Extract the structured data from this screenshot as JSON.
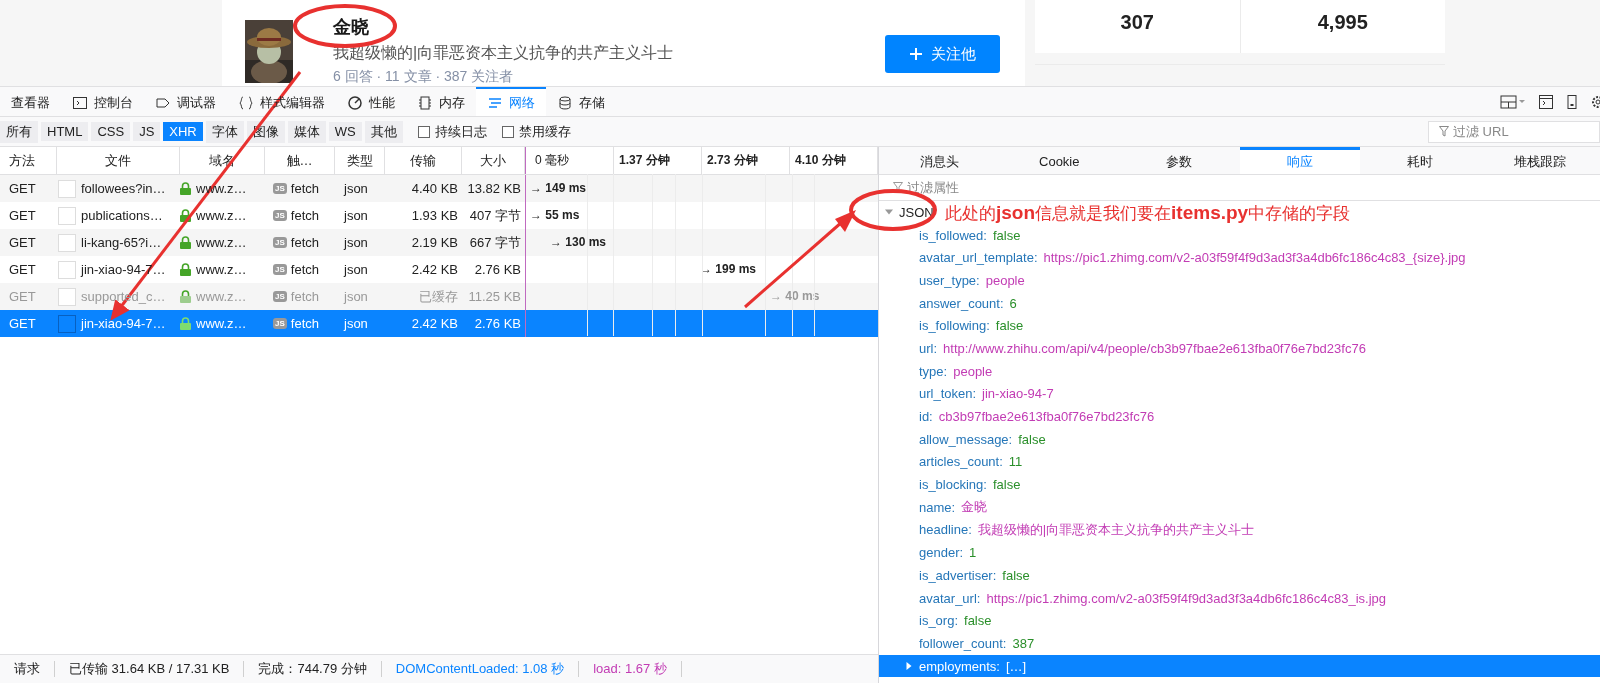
{
  "profile": {
    "name": "金晓",
    "headline": "我超级懒的|向罪恶资本主义抗争的共产主义斗士",
    "meta": "6 回答 · 11 文章 · 387 关注者",
    "follow_button": "关注他"
  },
  "stats": [
    "307",
    "4,995"
  ],
  "devtools": {
    "tabs": [
      {
        "label": "查看器",
        "selected": false
      },
      {
        "label": "控制台",
        "selected": false
      },
      {
        "label": "调试器",
        "selected": false
      },
      {
        "label": "样式编辑器",
        "selected": false
      },
      {
        "label": "性能",
        "selected": false
      },
      {
        "label": "内存",
        "selected": false
      },
      {
        "label": "网络",
        "selected": true
      },
      {
        "label": "存储",
        "selected": false
      }
    ],
    "filters": [
      {
        "label": "所有",
        "selected": false
      },
      {
        "label": "HTML",
        "selected": false
      },
      {
        "label": "CSS",
        "selected": false
      },
      {
        "label": "JS",
        "selected": false
      },
      {
        "label": "XHR",
        "selected": true
      },
      {
        "label": "字体",
        "selected": false
      },
      {
        "label": "图像",
        "selected": false
      },
      {
        "label": "媒体",
        "selected": false
      },
      {
        "label": "WS",
        "selected": false
      },
      {
        "label": "其他",
        "selected": false
      }
    ],
    "checkboxes": [
      {
        "label": "持续日志",
        "checked": false
      },
      {
        "label": "禁用缓存",
        "checked": false
      }
    ],
    "url_filter": {
      "placeholder": "过滤 URL"
    }
  },
  "requests": {
    "columns": [
      "方法",
      "文件",
      "域名",
      "触…",
      "类型",
      "传输",
      "大小"
    ],
    "timeline_ticks": [
      "0 毫秒",
      "1.37 分钟",
      "2.73 分钟",
      "4.10 分钟"
    ],
    "rows": [
      {
        "method": "GET",
        "file": "followees?in…",
        "domain": "www.z…",
        "badge": "JS",
        "cause": "fetch",
        "type": "json",
        "transferred": "4.40 KB",
        "size": "13.82 KB",
        "timing": "→ 149 ms",
        "cached": false,
        "selected": false
      },
      {
        "method": "GET",
        "file": "publications…",
        "domain": "www.z…",
        "badge": "JS",
        "cause": "fetch",
        "type": "json",
        "transferred": "1.93 KB",
        "size": "407 字节",
        "timing": "→ 55 ms",
        "cached": false,
        "selected": false
      },
      {
        "method": "GET",
        "file": "li-kang-65?i…",
        "domain": "www.z…",
        "badge": "JS",
        "cause": "fetch",
        "type": "json",
        "transferred": "2.19 KB",
        "size": "667 字节",
        "timing": "→ 130 ms",
        "cached": false,
        "selected": false
      },
      {
        "method": "GET",
        "file": "jin-xiao-94-7…",
        "domain": "www.z…",
        "badge": "JS",
        "cause": "fetch",
        "type": "json",
        "transferred": "2.42 KB",
        "size": "2.76 KB",
        "timing": "→ 199 ms",
        "cached": false,
        "selected": false
      },
      {
        "method": "GET",
        "file": "supported_c…",
        "domain": "www.z…",
        "badge": "JS",
        "cause": "fetch",
        "type": "json",
        "transferred": "已缓存",
        "size": "11.25 KB",
        "timing": "→ 40 ms",
        "cached": true,
        "selected": false
      },
      {
        "method": "GET",
        "file": "jin-xiao-94-7…",
        "domain": "www.z…",
        "badge": "JS",
        "cause": "fetch",
        "type": "json",
        "transferred": "2.42 KB",
        "size": "2.76 KB",
        "cached": false,
        "selected": true
      }
    ]
  },
  "status_bar": [
    {
      "text": "请求",
      "kind": "plain"
    },
    {
      "text": "已传输 31.64 KB / 17.31 KB",
      "kind": "plain"
    },
    {
      "text": "完成：744.79 分钟",
      "kind": "plain"
    },
    {
      "text": "DOMContentLoaded: 1.08 秒",
      "kind": "dcl"
    },
    {
      "text": "load: 1.67 秒",
      "kind": "load"
    }
  ],
  "response": {
    "tabs": [
      {
        "label": "消息头",
        "selected": false
      },
      {
        "label": "Cookie",
        "selected": false
      },
      {
        "label": "参数",
        "selected": false
      },
      {
        "label": "响应",
        "selected": true
      },
      {
        "label": "耗时",
        "selected": false
      },
      {
        "label": "堆栈跟踪",
        "selected": false
      }
    ],
    "filter": {
      "placeholder": "过滤属性"
    },
    "tree": {
      "label": "JSON",
      "expanded": true,
      "selected": false,
      "children": [
        {
          "key": "is_followed:",
          "value": "false",
          "kind": "literal",
          "selected": false
        },
        {
          "key": "avatar_url_template:",
          "value": "https://pic1.zhimg.com/v2-a03f59f4f9d3ad3f3a4db6fc186c4c83_{size}.jpg",
          "kind": "string",
          "selected": false
        },
        {
          "key": "user_type:",
          "value": "people",
          "kind": "string",
          "selected": false
        },
        {
          "key": "answer_count:",
          "value": "6",
          "kind": "literal",
          "selected": false
        },
        {
          "key": "is_following:",
          "value": "false",
          "kind": "literal",
          "selected": false
        },
        {
          "key": "url:",
          "value": "http://www.zhihu.com/api/v4/people/cb3b97fbae2e613fba0f76e7bd23fc76",
          "kind": "string",
          "selected": false
        },
        {
          "key": "type:",
          "value": "people",
          "kind": "string",
          "selected": false
        },
        {
          "key": "url_token:",
          "value": "jin-xiao-94-7",
          "kind": "string",
          "selected": false
        },
        {
          "key": "id:",
          "value": "cb3b97fbae2e613fba0f76e7bd23fc76",
          "kind": "string",
          "selected": false
        },
        {
          "key": "allow_message:",
          "value": "false",
          "kind": "literal",
          "selected": false
        },
        {
          "key": "articles_count:",
          "value": "11",
          "kind": "literal",
          "selected": false
        },
        {
          "key": "is_blocking:",
          "value": "false",
          "kind": "literal",
          "selected": false
        },
        {
          "key": "name:",
          "value": "金晓",
          "kind": "string",
          "selected": false
        },
        {
          "key": "headline:",
          "value": "我超级懒的|向罪恶资本主义抗争的共产主义斗士",
          "kind": "string",
          "selected": false
        },
        {
          "key": "gender:",
          "value": "1",
          "kind": "literal",
          "selected": false
        },
        {
          "key": "is_advertiser:",
          "value": "false",
          "kind": "literal",
          "selected": false
        },
        {
          "key": "avatar_url:",
          "value": "https://pic1.zhimg.com/v2-a03f59f4f9d3ad3f3a4db6fc186c4c83_is.jpg",
          "kind": "string",
          "selected": false
        },
        {
          "key": "is_org:",
          "value": "false",
          "kind": "literal",
          "selected": false
        },
        {
          "key": "follower_count:",
          "value": "387",
          "kind": "literal",
          "selected": false
        },
        {
          "key": "employments:",
          "value": "[…]",
          "kind": "array",
          "expanded": false,
          "selected": true
        }
      ]
    }
  },
  "annotation": {
    "note": "此处的**json**信息就是我们要在**items.py**中存储的字段"
  }
}
